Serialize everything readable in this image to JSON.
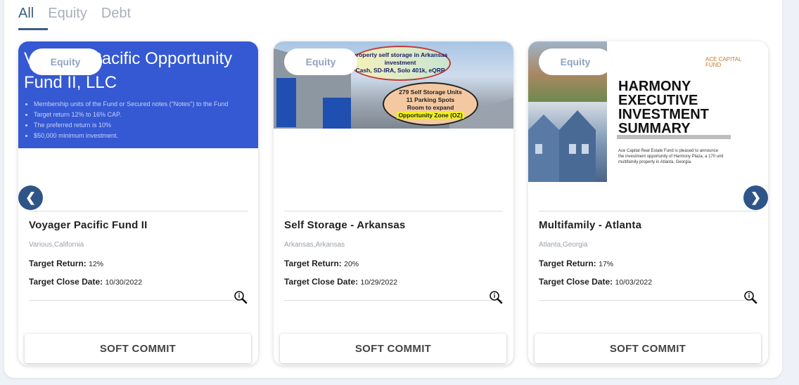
{
  "tabs": [
    {
      "label": "All",
      "active": true
    },
    {
      "label": "Equity",
      "active": false
    },
    {
      "label": "Debt",
      "active": false
    }
  ],
  "cards": [
    {
      "badge": "Equity",
      "media": {
        "heading_line1": "Voyager Pacific Opportunity",
        "heading_line2": "Fund II, LLC",
        "bullets": [
          "Membership units of the Fund or Secured notes (\"Notes\") to the Fund",
          "Target return 12% to 16% CAP.",
          "The preferred return is 10%",
          "$50,000 minimum investment."
        ]
      },
      "title": "Voyager Pacific Fund II",
      "location": "Various,California",
      "target_return_label": "Target Return:",
      "target_return": "12%",
      "close_date_label": "Target Close Date:",
      "close_date": "10/30/2022",
      "button": "SOFT COMMIT"
    },
    {
      "badge": "Equity",
      "media": {
        "oval1_line1": "property self storage in Arkansas",
        "oval1_line2": "investment",
        "oval1_line3": "Cash, SD-IRA, Solo 401k, eQRP",
        "oval2_line1": "279 Self Storage Units",
        "oval2_line2": "11 Parking Spots",
        "oval2_line3": "Room to expand",
        "oval2_line4": "Opportunity Zone (OZ)"
      },
      "title": "Self Storage - Arkansas",
      "location": "Arkansas,Arkansas",
      "target_return_label": "Target Return:",
      "target_return": "20%",
      "close_date_label": "Target Close Date:",
      "close_date": "10/29/2022",
      "button": "SOFT COMMIT"
    },
    {
      "badge": "Equity",
      "media": {
        "logo_line1": "ACE CAPITAL",
        "logo_line2": "FUND",
        "title_line1": "HARMONY",
        "title_line2": "EXECUTIVE",
        "title_line3": "INVESTMENT",
        "title_line4": "SUMMARY",
        "blurb": "Ace Capital Real Estate Fund is pleased to announce the investment opportunity of Harmony Plaza, a 170 unit multifamily property in Atlanta, Georgia."
      },
      "title": "Multifamily - Atlanta",
      "location": "Atlanta,Georgia",
      "target_return_label": "Target Return:",
      "target_return": "17%",
      "close_date_label": "Target Close Date:",
      "close_date": "10/03/2022",
      "button": "SOFT COMMIT"
    }
  ],
  "carousel": {
    "prev": "❮",
    "next": "❯"
  },
  "icons": {
    "zoom": "magnifier-icon",
    "prev": "chevron-left-icon",
    "next": "chevron-right-icon"
  }
}
